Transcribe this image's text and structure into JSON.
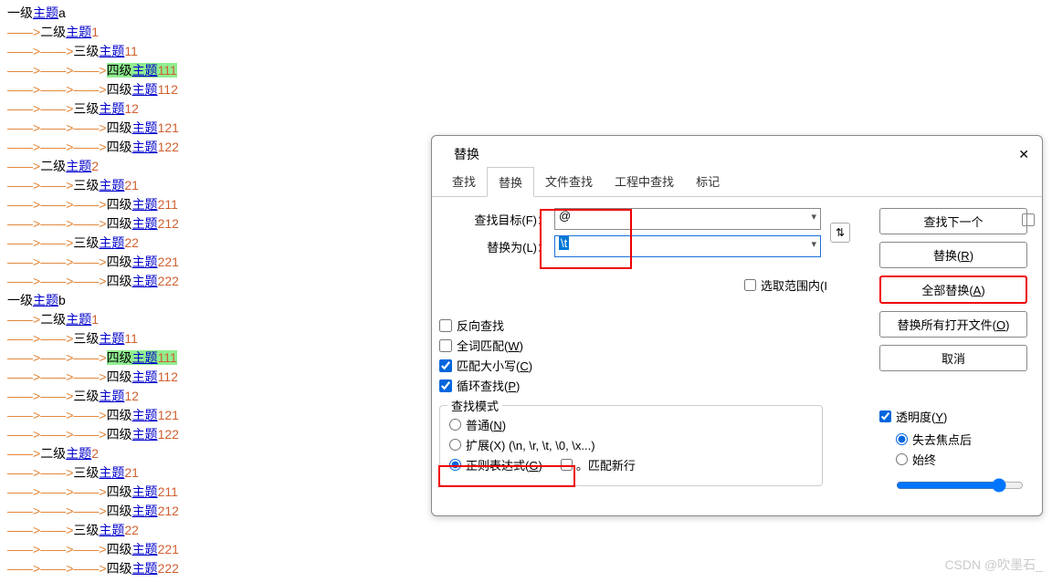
{
  "editor_lines": [
    {
      "indent": 0,
      "prefix": "一级",
      "suffix": "a",
      "num": "",
      "hl": false
    },
    {
      "indent": 1,
      "prefix": "二级",
      "suffix": "",
      "num": "1",
      "hl": false
    },
    {
      "indent": 2,
      "prefix": "三级",
      "suffix": "",
      "num": "11",
      "hl": false
    },
    {
      "indent": 3,
      "prefix": "四级",
      "suffix": "",
      "num": "111",
      "hl": true
    },
    {
      "indent": 3,
      "prefix": "四级",
      "suffix": "",
      "num": "112",
      "hl": false
    },
    {
      "indent": 2,
      "prefix": "三级",
      "suffix": "",
      "num": "12",
      "hl": false
    },
    {
      "indent": 3,
      "prefix": "四级",
      "suffix": "",
      "num": "121",
      "hl": false
    },
    {
      "indent": 3,
      "prefix": "四级",
      "suffix": "",
      "num": "122",
      "hl": false
    },
    {
      "indent": 1,
      "prefix": "二级",
      "suffix": "",
      "num": "2",
      "hl": false
    },
    {
      "indent": 2,
      "prefix": "三级",
      "suffix": "",
      "num": "21",
      "hl": false
    },
    {
      "indent": 3,
      "prefix": "四级",
      "suffix": "",
      "num": "211",
      "hl": false
    },
    {
      "indent": 3,
      "prefix": "四级",
      "suffix": "",
      "num": "212",
      "hl": false
    },
    {
      "indent": 2,
      "prefix": "三级",
      "suffix": "",
      "num": "22",
      "hl": false
    },
    {
      "indent": 3,
      "prefix": "四级",
      "suffix": "",
      "num": "221",
      "hl": false
    },
    {
      "indent": 3,
      "prefix": "四级",
      "suffix": "",
      "num": "222",
      "hl": false
    },
    {
      "indent": 0,
      "prefix": "一级",
      "suffix": "b",
      "num": "",
      "hl": false
    },
    {
      "indent": 1,
      "prefix": "二级",
      "suffix": "",
      "num": "1",
      "hl": false
    },
    {
      "indent": 2,
      "prefix": "三级",
      "suffix": "",
      "num": "11",
      "hl": false
    },
    {
      "indent": 3,
      "prefix": "四级",
      "suffix": "",
      "num": "111",
      "hl": true
    },
    {
      "indent": 3,
      "prefix": "四级",
      "suffix": "",
      "num": "112",
      "hl": false
    },
    {
      "indent": 2,
      "prefix": "三级",
      "suffix": "",
      "num": "12",
      "hl": false
    },
    {
      "indent": 3,
      "prefix": "四级",
      "suffix": "",
      "num": "121",
      "hl": false
    },
    {
      "indent": 3,
      "prefix": "四级",
      "suffix": "",
      "num": "122",
      "hl": false
    },
    {
      "indent": 1,
      "prefix": "二级",
      "suffix": "",
      "num": "2",
      "hl": false
    },
    {
      "indent": 2,
      "prefix": "三级",
      "suffix": "",
      "num": "21",
      "hl": false
    },
    {
      "indent": 3,
      "prefix": "四级",
      "suffix": "",
      "num": "211",
      "hl": false
    },
    {
      "indent": 3,
      "prefix": "四级",
      "suffix": "",
      "num": "212",
      "hl": false
    },
    {
      "indent": 2,
      "prefix": "三级",
      "suffix": "",
      "num": "22",
      "hl": false
    },
    {
      "indent": 3,
      "prefix": "四级",
      "suffix": "",
      "num": "221",
      "hl": false
    },
    {
      "indent": 3,
      "prefix": "四级",
      "suffix": "",
      "num": "222",
      "hl": false
    }
  ],
  "zhuti_word": "主题",
  "arrow_glyph": "——>",
  "dialog": {
    "title": "替换",
    "tabs": [
      "查找",
      "替换",
      "文件查找",
      "工程中查找",
      "标记"
    ],
    "active_tab": 1,
    "find_label": "查找目标(F)：",
    "find_value": "@",
    "replace_label": "替换为(L)：",
    "replace_value": "\\t",
    "swap_icon": "⇅",
    "in_selection": "选取范围内(I",
    "buttons": {
      "find_next": "查找下一个",
      "replace": "替换(R)",
      "replace_all": "全部替换(A)",
      "replace_open": "替换所有打开文件(O)",
      "cancel": "取消"
    },
    "opts": {
      "backward": "反向查找",
      "whole_word": "全词匹配(W)",
      "match_case": "匹配大小写(C)",
      "wrap": "循环查找(P)"
    },
    "search_mode": {
      "legend": "查找模式",
      "normal": "普通(N)",
      "extended": "扩展(X) (\\n, \\r, \\t, \\0, \\x...)",
      "regex": "正则表达式(G)",
      "dot_newline": "。匹配新行"
    },
    "transparency": {
      "label": "透明度(Y)",
      "lose_focus": "失去焦点后",
      "always": "始终"
    }
  },
  "watermark": "CSDN @吹墨石_"
}
